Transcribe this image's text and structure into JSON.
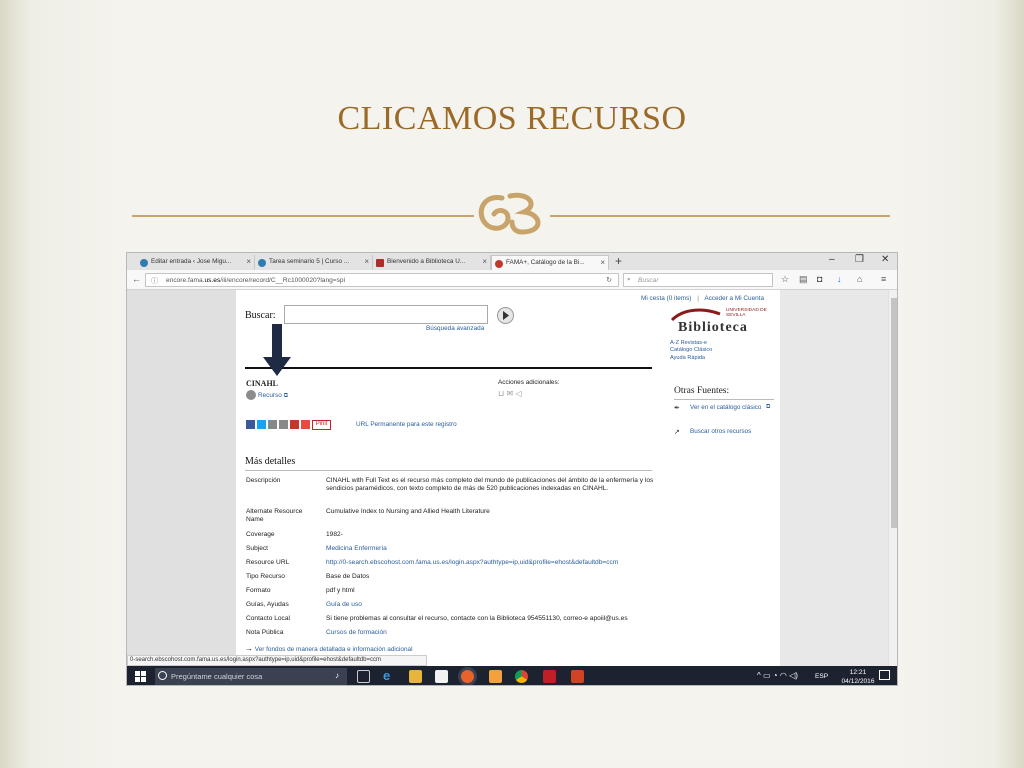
{
  "slide": {
    "title": "CLICAMOS RECURSO"
  },
  "browser": {
    "tabs": [
      {
        "label": "Editar entrada ‹ Jose Migu...",
        "icon": "wordpress-icon"
      },
      {
        "label": "Tarea seminario 5 | Curso ...",
        "icon": "wordpress-icon"
      },
      {
        "label": "Bienvenido a Biblioteca U...",
        "icon": "library-icon"
      },
      {
        "label": "FAMA+, Catálogo de la Bi...",
        "icon": "fama-icon"
      }
    ],
    "url_prefix": "encore.fama.",
    "url_domain": "us.es",
    "url_rest": "/iii/encore/record/C__Rc1000020?lang=spi",
    "search_placeholder": "Buscar",
    "status_url": "0-search.ebscohost.com.fama.us.es/login.aspx?authtype=ip,uid&profile=ehost&defaultdb=ccm"
  },
  "page": {
    "top_links": {
      "cesta": "Mi cesta (0 items)",
      "sep": "|",
      "acceder": "Acceder a Mi Cuenta"
    },
    "search_label": "Buscar:",
    "advanced_search": "Búsqueda avanzada",
    "logo": {
      "small": "UNIVERSIDAD DE SEVILLA",
      "name": "Biblioteca",
      "links": [
        "A-Z Revistas-e",
        "Catálogo Clásico",
        "Ayuda Rápida"
      ]
    },
    "record_title": "CINAHL",
    "resource_link": "Recurso",
    "actions_label": "Acciones adicionales:",
    "pinit": "Pinit",
    "permalink": "URL Permanente para este registro",
    "otras_fuentes": {
      "title": "Otras Fuentes:",
      "items": [
        "Ver en el catálogo clásico",
        "Buscar otros recursos"
      ]
    },
    "mas_detalles": "Más detalles",
    "details": [
      {
        "label": "Descripción",
        "value": "CINAHL with Full Text es el recurso más completo del mundo de publicaciones del ámbito de la enfermería y los sendicios paramédicos, con texto completo de más de 520 publicaciones indexadas en CINAHL.",
        "link": false
      },
      {
        "label": "Alternate Resource Name",
        "value": "Cumulative Index to Nursing and Allied Health Literature",
        "link": false
      },
      {
        "label": "Coverage",
        "value": "1982-",
        "link": false
      },
      {
        "label": "Subject",
        "value": "Medicina Enfermería",
        "link": true
      },
      {
        "label": "Resource URL",
        "value": "http://0-search.ebscohost.com.fama.us.es/login.aspx?authtype=ip,uid&profile=ehost&defaultdb=ccm",
        "link": true
      },
      {
        "label": "Tipo Recurso",
        "value": "Base de Datos",
        "link": false
      },
      {
        "label": "Formato",
        "value": "pdf y html",
        "link": false
      },
      {
        "label": "Guías, Ayudas",
        "value": "Guía de uso",
        "link": true
      },
      {
        "label": "Contacto Local",
        "value": "Si tiene problemas al consultar el recurso, contacte con la Biblioteca 954551130, correo-e apoiil@us.es",
        "link": false
      },
      {
        "label": "Nota Pública",
        "value": "Cursos de formación",
        "link": true
      }
    ],
    "more_link": "Ver fondos de manera detallada e información adicional"
  },
  "taskbar": {
    "search_placeholder": "Pregúntame cualquier cosa",
    "lang": "ESP",
    "time": "12:21",
    "date": "04/12/2016"
  },
  "colors": {
    "title": "#9b6a28",
    "ornament": "#c8a46a",
    "link": "#2b5d9b",
    "taskbar": "#1c2230",
    "arrow": "#1f2a44"
  }
}
